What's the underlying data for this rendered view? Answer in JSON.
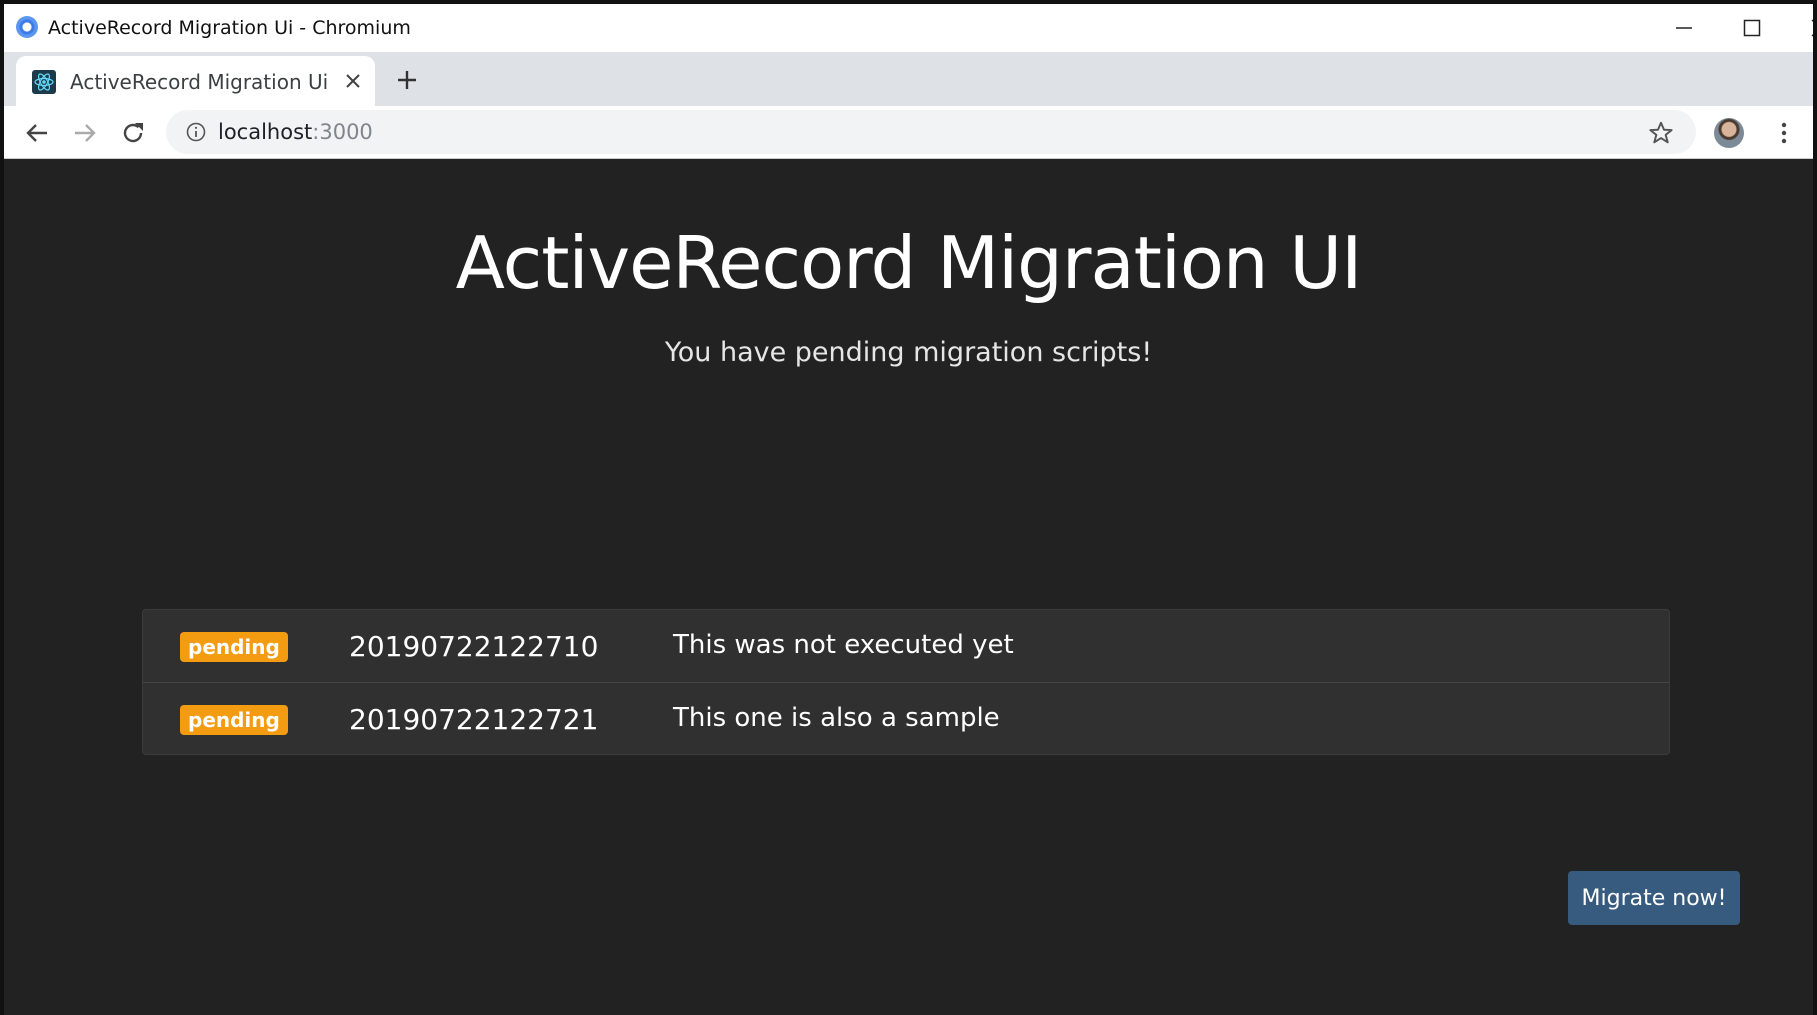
{
  "window": {
    "title": "ActiveRecord Migration Ui - Chromium"
  },
  "tab": {
    "label": "ActiveRecord Migration Ui"
  },
  "address_bar": {
    "host": "localhost",
    "port": ":3000"
  },
  "page": {
    "title": "ActiveRecord Migration UI",
    "subtitle": "You have pending migration scripts!",
    "migrations": [
      {
        "status": "pending",
        "version": "20190722122710",
        "description": "This was not executed yet"
      },
      {
        "status": "pending",
        "version": "20190722122721",
        "description": "This one is also a sample"
      }
    ],
    "migrate_button": "Migrate now!"
  },
  "colors": {
    "page_background": "#222222",
    "pending_badge": "#f39c12",
    "primary_button": "#375a7f"
  }
}
